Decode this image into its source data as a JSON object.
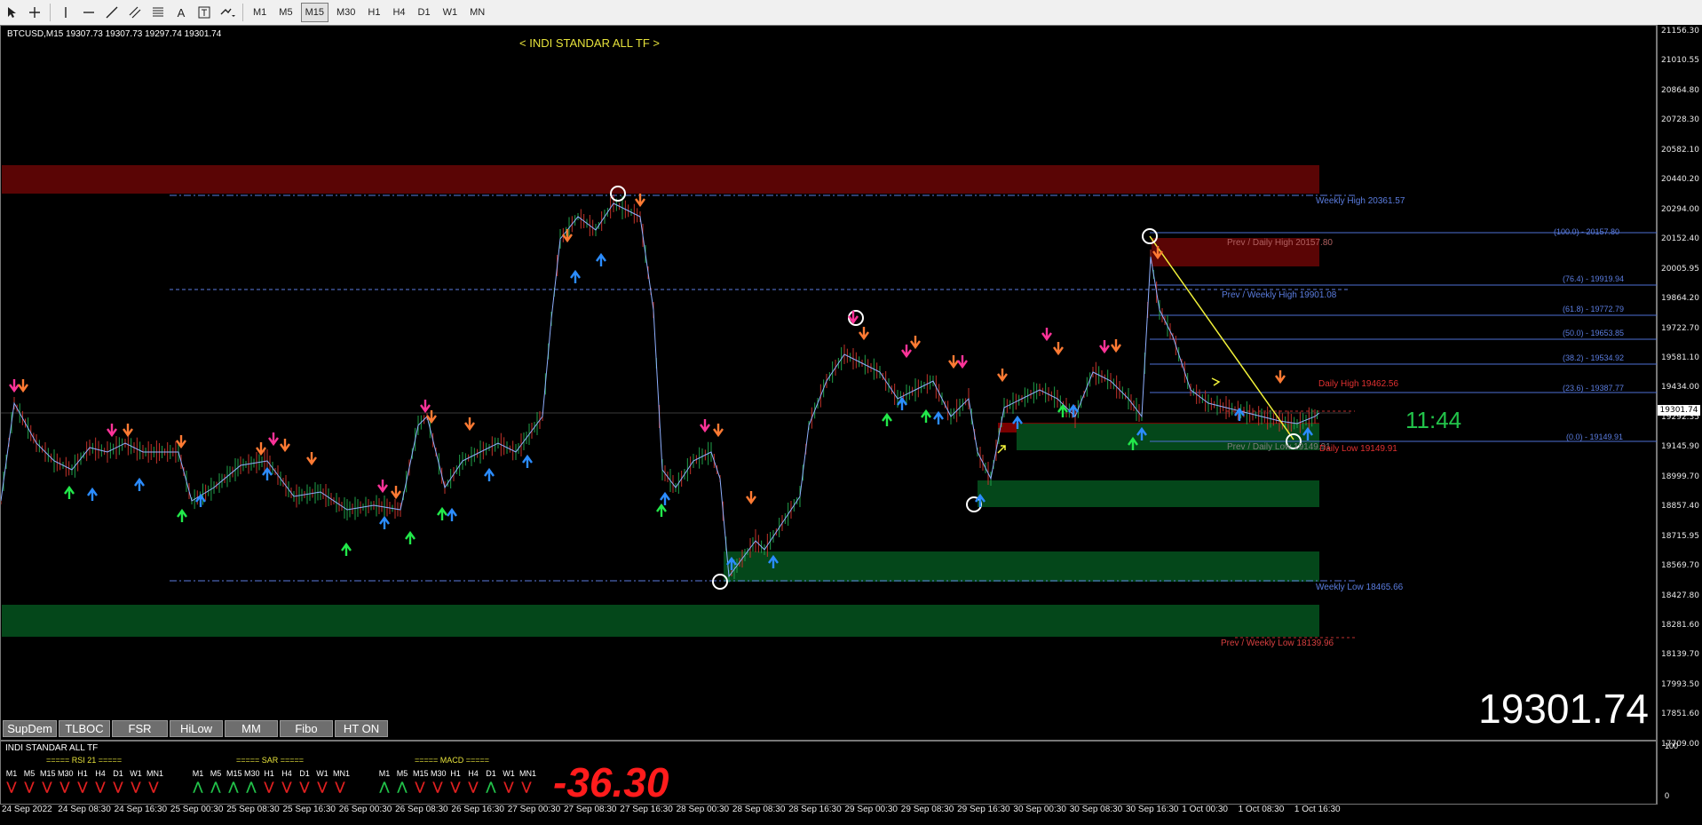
{
  "toolbar": {
    "tools": [
      "cursor-icon",
      "crosshair-icon",
      "vertical-line-icon",
      "horizontal-line-icon",
      "trendline-icon",
      "channel-icon",
      "fibo-icon",
      "text-icon",
      "label-icon",
      "shapes-icon"
    ],
    "timeframes": [
      "M1",
      "M5",
      "M15",
      "M30",
      "H1",
      "H4",
      "D1",
      "W1",
      "MN"
    ],
    "active_timeframe": "M15"
  },
  "chart": {
    "symbol_line": "BTCUSD,M15  19307.73 19307.73 19297.74 19301.74",
    "indicator_title": "< INDI STANDAR ALL TF >",
    "timer": "11:44",
    "big_price": "19301.74",
    "current_price_tag": "19301.74",
    "colors": {
      "bull": "#1fa24a",
      "bear": "#c4322a",
      "supply": "#5a0505",
      "demand": "#04471a",
      "fib": "#4e6fd3",
      "trend": "#f2f23a"
    }
  },
  "price_axis": [
    "21156.30",
    "21010.55",
    "20864.80",
    "20728.30",
    "20582.10",
    "20440.20",
    "20294.00",
    "20152.40",
    "20005.95",
    "19864.20",
    "19722.70",
    "19581.10",
    "19434.00",
    "19292.35",
    "19145.90",
    "18999.70",
    "18857.40",
    "18715.95",
    "18569.70",
    "18427.80",
    "18281.60",
    "18139.70",
    "17993.50",
    "17851.60",
    "17709.00"
  ],
  "levels": {
    "weekly_high": "Weekly High 20361.57",
    "prev_daily_high": "Prev / Daily High 20157.80",
    "prev_weekly_high": "Prev / Weekly High 19901.08",
    "daily_high": "Daily High 19462.56",
    "prev_daily_low": "Prev / Daily Low 19149.91",
    "daily_low": "Daily Low 19149.91",
    "weekly_low": "Weekly Low 18465.66",
    "prev_weekly_low": "Prev / Weekly Low 18139.96"
  },
  "fibo": [
    "(100.0) - 20157.80",
    "(76.4) - 19919.94",
    "(61.8) - 19772.79",
    "(50.0) - 19653.85",
    "(38.2) - 19534.92",
    "(23.6) - 19387.77",
    "(0.0) - 19149.91"
  ],
  "tabs": [
    "SupDem",
    "TLBOC",
    "FSR",
    "HiLow",
    "MM",
    "Fibo",
    "HT ON"
  ],
  "subwindow": {
    "title": "INDI STANDAR ALL TF",
    "rsi_header": "===== RSI 21 =====",
    "sar_header": "===== SAR =====",
    "macd_header": "===== MACD =====",
    "tf_labels": [
      "M1",
      "M5",
      "M15",
      "M30",
      "H1",
      "H4",
      "D1",
      "W1",
      "MN1"
    ],
    "rsi_arrows": [
      "down",
      "down",
      "down",
      "down",
      "down",
      "down",
      "down",
      "down",
      "down"
    ],
    "sar_arrows": [
      "up",
      "up",
      "up",
      "up",
      "down",
      "down",
      "down",
      "down",
      "down"
    ],
    "macd_arrows": [
      "up",
      "up",
      "down",
      "down",
      "down",
      "down",
      "up",
      "down",
      "down"
    ],
    "value": "-36.30",
    "axis_top": "100",
    "axis_bottom": "0"
  },
  "time_axis": [
    "24 Sep 2022",
    "24 Sep 08:30",
    "24 Sep 16:30",
    "25 Sep 00:30",
    "25 Sep 08:30",
    "25 Sep 16:30",
    "26 Sep 00:30",
    "26 Sep 08:30",
    "26 Sep 16:30",
    "27 Sep 00:30",
    "27 Sep 08:30",
    "27 Sep 16:30",
    "28 Sep 00:30",
    "28 Sep 08:30",
    "28 Sep 16:30",
    "29 Sep 00:30",
    "29 Sep 08:30",
    "29 Sep 16:30",
    "30 Sep 00:30",
    "30 Sep 08:30",
    "30 Sep 16:30",
    "1 Oct 00:30",
    "1 Oct 08:30",
    "1 Oct 16:30"
  ]
}
